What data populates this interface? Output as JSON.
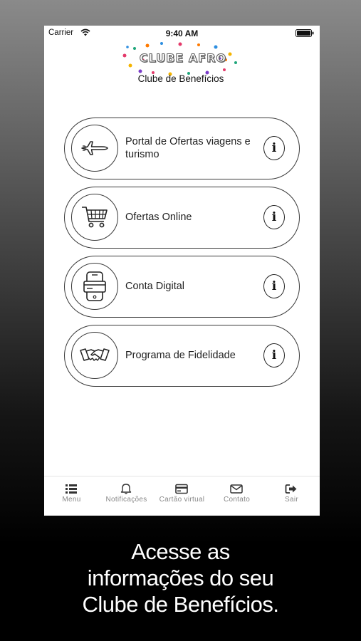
{
  "status_bar": {
    "carrier": "Carrier",
    "time": "9:40 AM"
  },
  "header": {
    "logo_text": "CLUBE AFRO",
    "subtitle": "Clube de Benefícios"
  },
  "cards": [
    {
      "label": "Portal de Ofertas viagens e turismo",
      "icon": "airplane-icon",
      "info": "i"
    },
    {
      "label": "Ofertas Online",
      "icon": "shopping-cart-icon",
      "info": "i"
    },
    {
      "label": "Conta Digital",
      "icon": "phone-card-icon",
      "info": "i"
    },
    {
      "label": "Programa de Fidelidade",
      "icon": "handshake-icon",
      "info": "i"
    }
  ],
  "tab_bar": [
    {
      "label": "Menu",
      "icon": "list-icon"
    },
    {
      "label": "Notificações",
      "icon": "bell-icon"
    },
    {
      "label": "Cartão virtual",
      "icon": "credit-card-icon"
    },
    {
      "label": "Contato",
      "icon": "envelope-icon"
    },
    {
      "label": "Sair",
      "icon": "sign-out-icon"
    }
  ],
  "caption": {
    "line1": "Acesse as",
    "line2": "informações do seu",
    "line3": "Clube de Benefícios."
  }
}
